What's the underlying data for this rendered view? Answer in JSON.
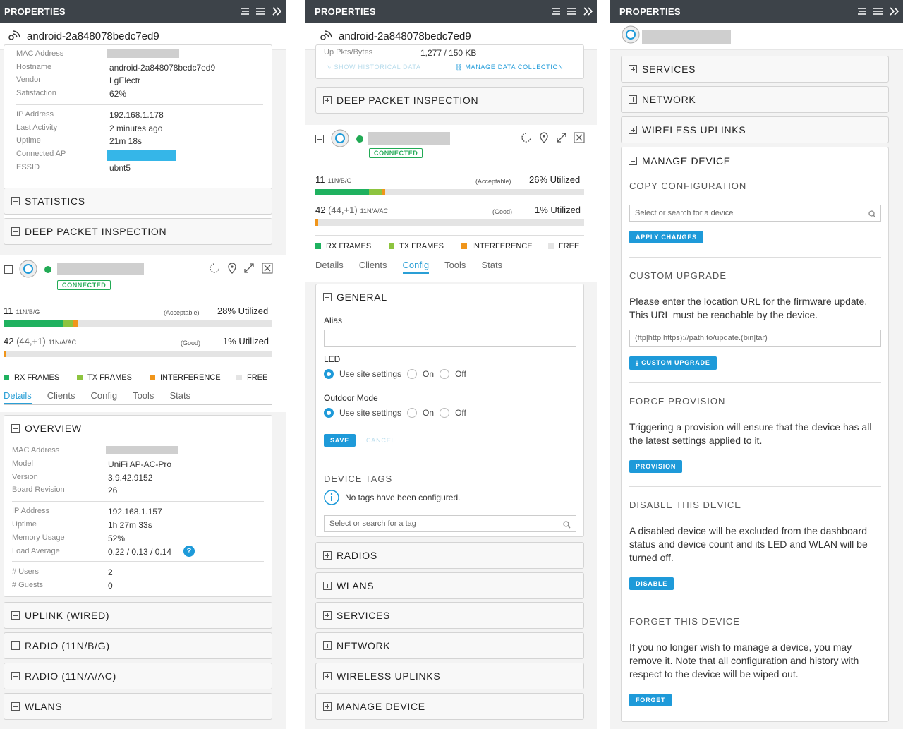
{
  "colors": {
    "accent": "#1e9ad9",
    "connected": "#22aa55",
    "rx": "#1fb15f",
    "tx": "#8dc43f",
    "interference": "#f0951a",
    "free": "#e4e4e4",
    "header": "#3d4349"
  },
  "common": {
    "header_title": "PROPERTIES",
    "client_name": "android-2a848078bedc7ed9",
    "connected": "CONNECTED"
  },
  "p1": {
    "client": {
      "rows": [
        {
          "k": "MAC Address",
          "v": ""
        },
        {
          "k": "Hostname",
          "v": "android-2a848078bedc7ed9"
        },
        {
          "k": "Vendor",
          "v": "LgElectr"
        },
        {
          "k": "Satisfaction",
          "v": "62%"
        },
        {
          "k": "IP Address",
          "v": "192.168.1.178"
        },
        {
          "k": "Last Activity",
          "v": "2 minutes ago"
        },
        {
          "k": "Uptime",
          "v": "21m 18s"
        },
        {
          "k": "Connected AP",
          "v": ""
        },
        {
          "k": "ESSID",
          "v": "ubnt5"
        }
      ]
    },
    "sections_top": [
      "STATISTICS",
      "DEEP PACKET INSPECTION"
    ],
    "radio1": {
      "channel": "11",
      "mode": "11N/B/G",
      "quality": "(Acceptable)",
      "util": "28% Utilized",
      "rx": 0.22,
      "tx": 0.04,
      "interference": 0.015
    },
    "radio2": {
      "channel": "42",
      "extra": "(44,+1)",
      "mode": "11N/A/AC",
      "quality": "(Good)",
      "util": "1% Utilized",
      "rx": 0.0,
      "tx": 0.0,
      "interference": 0.01
    },
    "legend": [
      "RX FRAMES",
      "TX FRAMES",
      "INTERFERENCE",
      "FREE"
    ],
    "tabs": [
      "Details",
      "Clients",
      "Config",
      "Tools",
      "Stats"
    ],
    "overview": {
      "title": "OVERVIEW",
      "rows": [
        {
          "k": "MAC Address",
          "v": ""
        },
        {
          "k": "Model",
          "v": "UniFi AP-AC-Pro"
        },
        {
          "k": "Version",
          "v": "3.9.42.9152"
        },
        {
          "k": "Board Revision",
          "v": "26"
        },
        {
          "k": "IP Address",
          "v": "192.168.1.157"
        },
        {
          "k": "Uptime",
          "v": "1h 27m 33s"
        },
        {
          "k": "Memory Usage",
          "v": "52%"
        },
        {
          "k": "Load Average",
          "v": "0.22 / 0.13 / 0.14"
        },
        {
          "k": "# Users",
          "v": "2"
        },
        {
          "k": "# Guests",
          "v": "0"
        }
      ]
    },
    "sections_bottom": [
      "UPLINK (WIRED)",
      "RADIO (11N/B/G)",
      "RADIO (11N/A/AC)",
      "WLANS"
    ]
  },
  "p2": {
    "partial_row": {
      "k": "Up Pkts/Bytes",
      "v": "1,277 / 150 KB"
    },
    "show_hist": "SHOW HISTORICAL DATA",
    "manage_data": "MANAGE DATA COLLECTION",
    "dpi": "DEEP PACKET INSPECTION",
    "radio1": {
      "channel": "11",
      "mode": "11N/B/G",
      "quality": "(Acceptable)",
      "util": "26% Utilized",
      "rx": 0.2,
      "tx": 0.05,
      "interference": 0.01
    },
    "radio2": {
      "channel": "42",
      "extra": "(44,+1)",
      "mode": "11N/A/AC",
      "quality": "(Good)",
      "util": "1% Utilized",
      "rx": 0.0,
      "tx": 0.0,
      "interference": 0.01
    },
    "tabs": [
      "Details",
      "Clients",
      "Config",
      "Tools",
      "Stats"
    ],
    "general": {
      "title": "GENERAL",
      "alias_label": "Alias",
      "alias_value": "",
      "led_label": "LED",
      "outdoor_label": "Outdoor Mode",
      "opt_site": "Use site settings",
      "opt_on": "On",
      "opt_off": "Off",
      "save": "SAVE",
      "cancel": "CANCEL"
    },
    "tags": {
      "title": "DEVICE TAGS",
      "empty": "No tags have been configured.",
      "placeholder": "Select or search for a tag"
    },
    "sections": [
      "RADIOS",
      "WLANS",
      "SERVICES",
      "NETWORK",
      "WIRELESS UPLINKS",
      "MANAGE DEVICE"
    ]
  },
  "p3": {
    "sections": [
      "SERVICES",
      "NETWORK",
      "WIRELESS UPLINKS"
    ],
    "manage": {
      "title": "MANAGE DEVICE",
      "copy_title": "COPY CONFIGURATION",
      "copy_placeholder": "Select or search for a device",
      "apply": "APPLY CHANGES",
      "upgrade_title": "CUSTOM UPGRADE",
      "upgrade_text": "Please enter the location URL for the firmware update. This URL must be reachable by the device.",
      "upgrade_placeholder": "(ftp|http|https)://path.to/update.(bin|tar)",
      "upgrade_btn": "CUSTOM UPGRADE",
      "force_title": "FORCE PROVISION",
      "force_text": "Triggering a provision will ensure that the device has all the latest settings applied to it.",
      "force_btn": "PROVISION",
      "disable_title": "DISABLE THIS DEVICE",
      "disable_text": "A disabled device will be excluded from the dashboard status and device count and its LED and WLAN will be turned off.",
      "disable_btn": "DISABLE",
      "forget_title": "FORGET THIS DEVICE",
      "forget_text": "If you no longer wish to manage a device, you may remove it. Note that all configuration and history with respect to the device will be wiped out.",
      "forget_btn": "FORGET"
    }
  }
}
